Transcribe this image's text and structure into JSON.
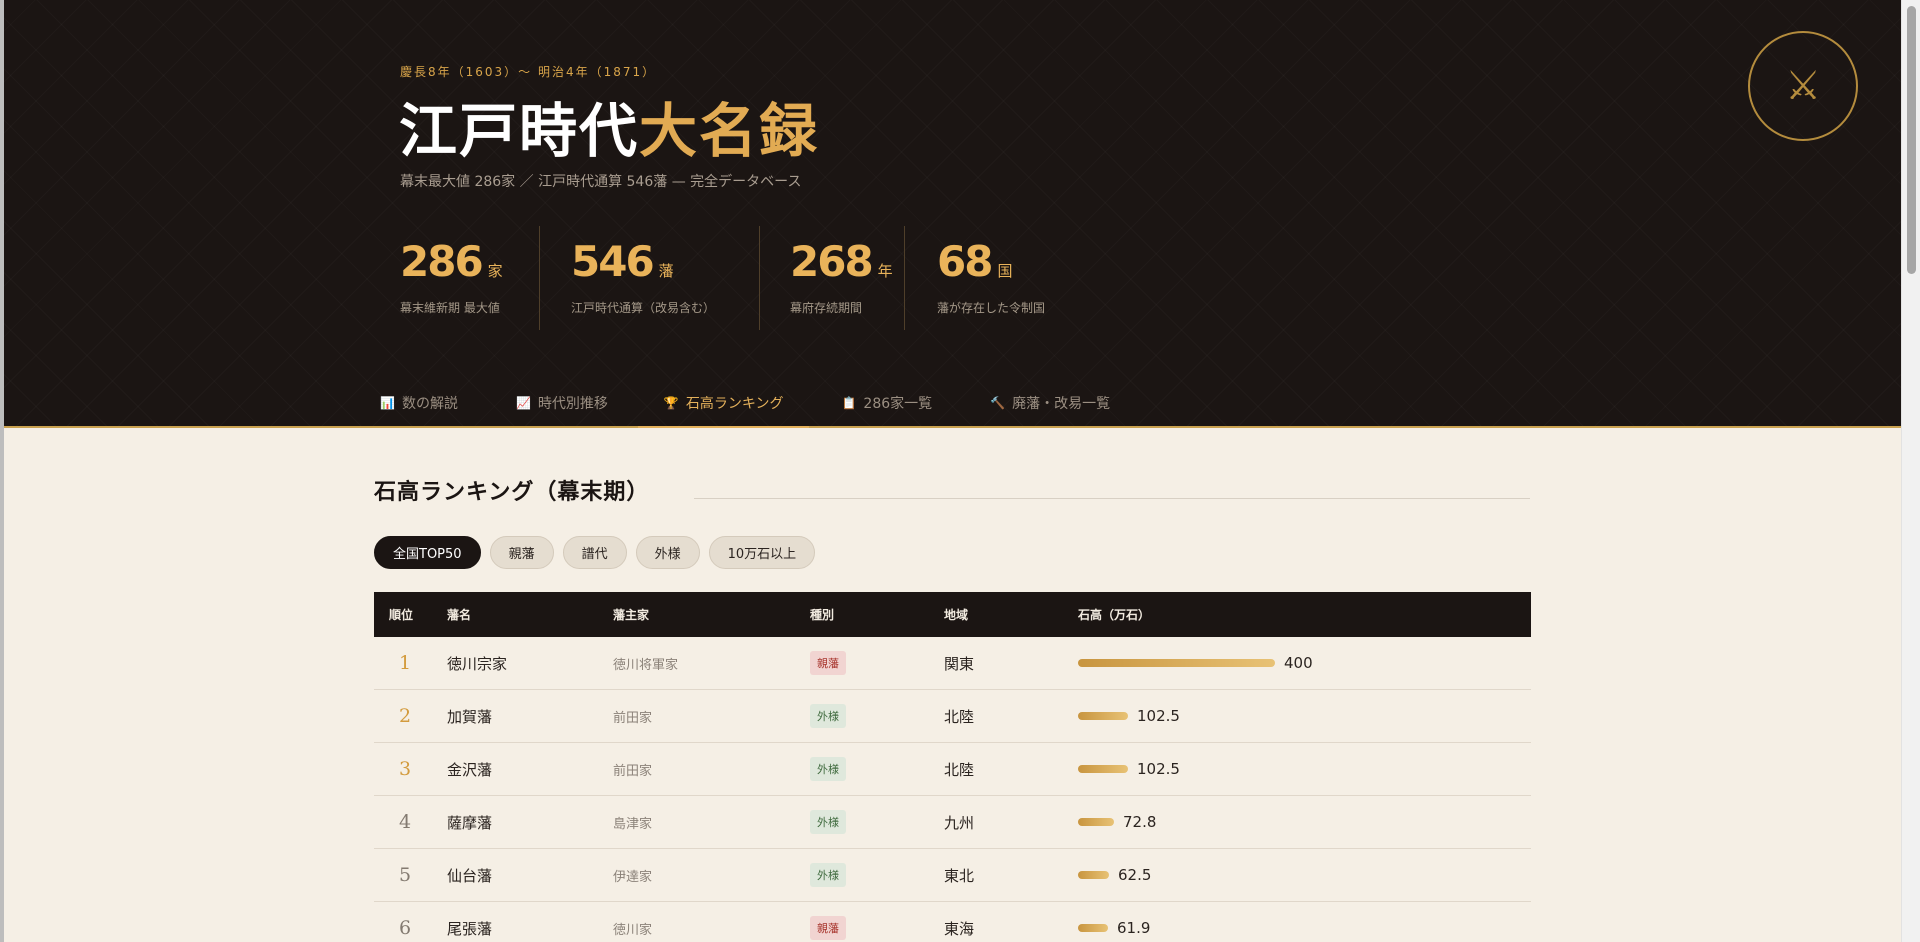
{
  "hero": {
    "period": "慶長8年（1603）〜 明治4年（1871）",
    "title_main": "江戸時代",
    "title_accent": "大名録",
    "subtitle": "幕末最大値 286家 ／ 江戸時代通算 546藩 — 完全データベース",
    "emblem_icon": "crossed-swords-icon",
    "stats": [
      {
        "number": "286",
        "unit": "家",
        "label": "幕末維新期 最大値"
      },
      {
        "number": "546",
        "unit": "藩",
        "label": "江戸時代通算（改易含む）"
      },
      {
        "number": "268",
        "unit": "年",
        "label": "幕府存続期間"
      },
      {
        "number": "68",
        "unit": "国",
        "label": "藩が存在した令制国"
      }
    ]
  },
  "tabs": [
    {
      "label": "数の解説",
      "icon": "📊"
    },
    {
      "label": "時代別推移",
      "icon": "📈"
    },
    {
      "label": "石高ランキング",
      "icon": "🏆"
    },
    {
      "label": "286家一覧",
      "icon": "📋"
    },
    {
      "label": "廃藩・改易一覧",
      "icon": "🔨"
    }
  ],
  "active_tab": "石高ランキング",
  "section": {
    "title": "石高ランキング（幕末期）"
  },
  "filters": [
    "全国TOP50",
    "親藩",
    "譜代",
    "外様",
    "10万石以上"
  ],
  "active_filter": "全国TOP50",
  "table": {
    "headers": [
      "順位",
      "藩名",
      "藩主家",
      "種別",
      "地域",
      "石高（万石）"
    ],
    "max_koku": 400,
    "rows": [
      {
        "rank": "1",
        "name": "徳川宗家",
        "lord": "徳川将軍家",
        "type": "親藩",
        "area": "関東",
        "koku": "400"
      },
      {
        "rank": "2",
        "name": "加賀藩",
        "lord": "前田家",
        "type": "外様",
        "area": "北陸",
        "koku": "102.5"
      },
      {
        "rank": "3",
        "name": "金沢藩",
        "lord": "前田家",
        "type": "外様",
        "area": "北陸",
        "koku": "102.5"
      },
      {
        "rank": "4",
        "name": "薩摩藩",
        "lord": "島津家",
        "type": "外様",
        "area": "九州",
        "koku": "72.8"
      },
      {
        "rank": "5",
        "name": "仙台藩",
        "lord": "伊達家",
        "type": "外様",
        "area": "東北",
        "koku": "62.5"
      },
      {
        "rank": "6",
        "name": "尾張藩",
        "lord": "徳川家",
        "type": "親藩",
        "area": "東海",
        "koku": "61.9"
      }
    ]
  },
  "colors": {
    "accent": "#e2ab53",
    "dark": "#1b1513",
    "background": "#f5efe5",
    "shinpan_badge": "#f1d4d1",
    "tozama_badge": "#dfe8dc"
  }
}
